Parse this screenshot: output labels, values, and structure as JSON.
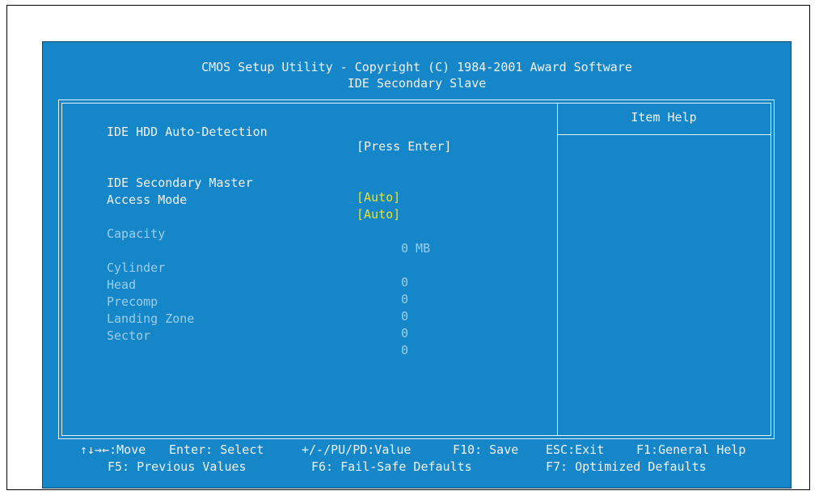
{
  "header": {
    "line1": "CMOS Setup Utility - Copyright (C) 1984-2001 Award Software",
    "line2": "IDE Secondary Slave"
  },
  "help_panel": {
    "title": "Item Help"
  },
  "items": [
    {
      "label": "IDE HDD Auto-Detection",
      "value": "[Press Enter]"
    },
    {
      "label": "IDE Secondary Master",
      "value": "[Auto]"
    },
    {
      "label": "Access Mode",
      "value": "[Auto]"
    },
    {
      "label": "Capacity",
      "value": "0 MB"
    },
    {
      "label": "Cylinder",
      "value": "0"
    },
    {
      "label": "Head",
      "value": "0"
    },
    {
      "label": "Precomp",
      "value": "0"
    },
    {
      "label": "Landing Zone",
      "value": "0"
    },
    {
      "label": "Sector",
      "value": "0"
    }
  ],
  "footer": {
    "move": "↑↓→←:Move",
    "enter": "Enter: Select",
    "value": "+/-/PU/PD:Value",
    "save": "F10: Save",
    "exit": "ESC:Exit",
    "help": "F1:General Help",
    "previous": "F5: Previous Values",
    "failsafe": "F6: Fail-Safe Defaults",
    "optimized": "F7: Optimized Defaults"
  },
  "colors": {
    "background": "#1587c9",
    "text": "#f2f2f2",
    "selected_value": "#f0e01e",
    "disabled": "#9ccde9"
  }
}
